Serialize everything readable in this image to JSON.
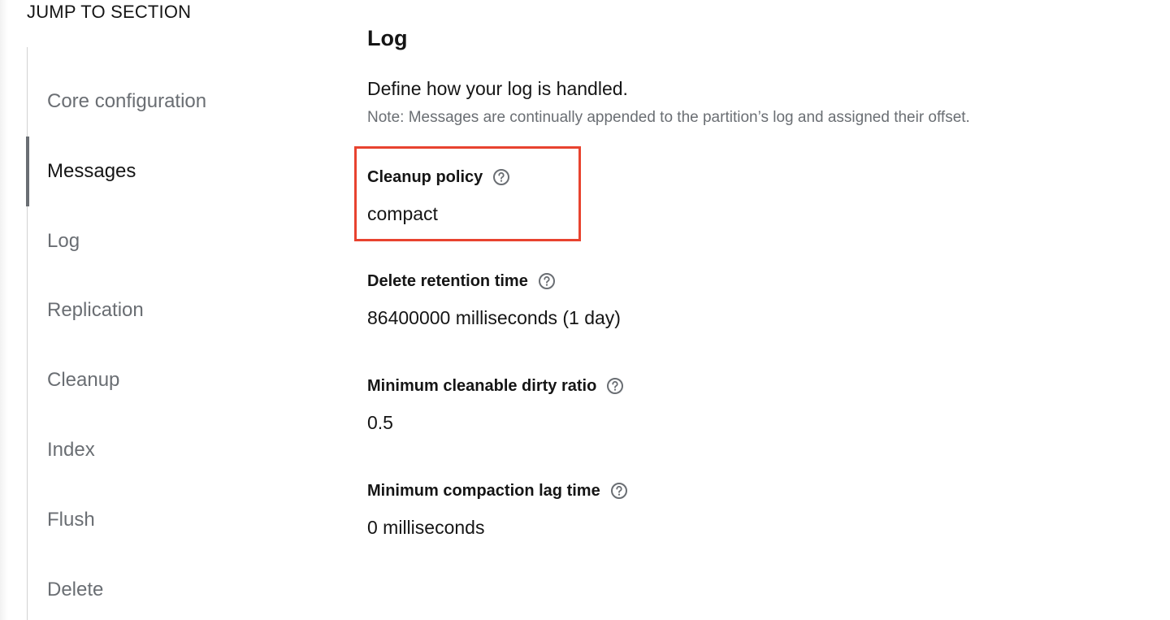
{
  "jump": {
    "title": "JUMP TO SECTION",
    "items": [
      {
        "label": "Core configuration"
      },
      {
        "label": "Messages",
        "active": true
      },
      {
        "label": "Log"
      },
      {
        "label": "Replication"
      },
      {
        "label": "Cleanup"
      },
      {
        "label": "Index"
      },
      {
        "label": "Flush"
      },
      {
        "label": "Delete"
      }
    ]
  },
  "section": {
    "title": "Log",
    "description": "Define how your log is handled.",
    "note": "Note: Messages are continually appended to the partition’s log and assigned their offset."
  },
  "fields": [
    {
      "label": "Cleanup policy",
      "value": "compact",
      "icon": "help-circle-icon"
    },
    {
      "label": "Delete retention time",
      "value": "86400000 milliseconds (1 day)",
      "icon": "help-circle-icon"
    },
    {
      "label": "Minimum cleanable dirty ratio",
      "value": "0.5",
      "icon": "help-circle-icon"
    },
    {
      "label": "Minimum compaction lag time",
      "value": "0 milliseconds",
      "icon": "help-circle-icon"
    }
  ],
  "colors": {
    "highlight": "#e8432f",
    "active_indicator": "#6a6e73",
    "muted_text": "#6a6e73"
  }
}
